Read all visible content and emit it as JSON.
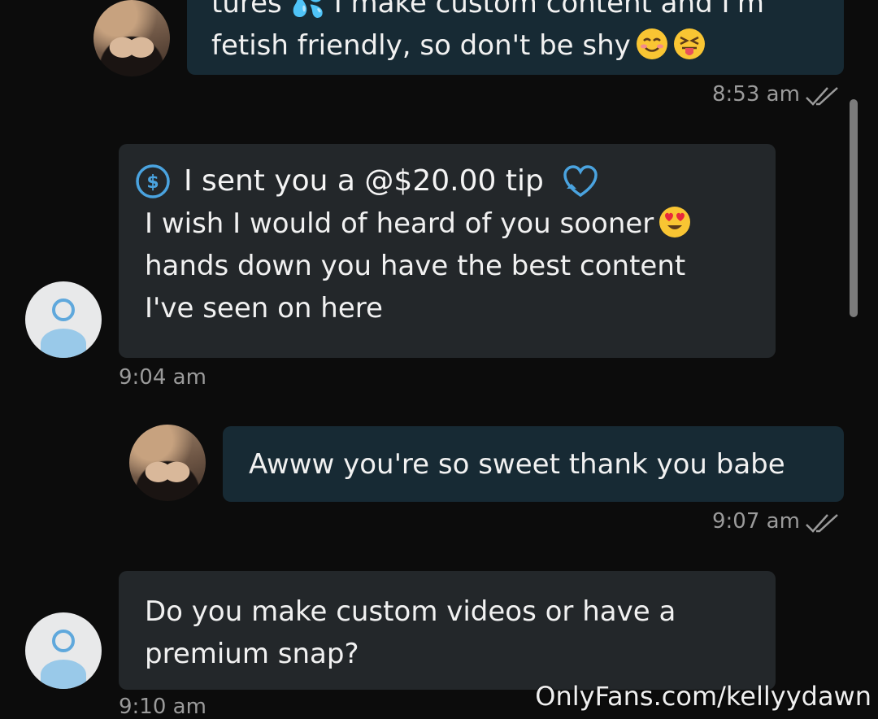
{
  "messages": [
    {
      "sender": "creator",
      "lines": [
        "tures 💦 I make custom content and I'm",
        "fetish friendly, so don't be shy"
      ],
      "emojis": [
        "smiling-face-icon",
        "squinting-tongue-face-icon"
      ],
      "time": "8:53 am",
      "status": "read"
    },
    {
      "sender": "fan",
      "tip_label": "I sent you a @$20.00 tip",
      "tip_icon": "dollar-circle-icon",
      "tip_badge_icon": "heart-icon",
      "lines": [
        "I wish I would of heard of you sooner",
        "hands down you have the best content",
        "I've seen on here"
      ],
      "emojis": [
        "heart-eyes-face-icon"
      ],
      "time": "9:04 am"
    },
    {
      "sender": "creator",
      "lines": [
        "Awww you're so sweet thank you babe"
      ],
      "time": "9:07 am",
      "status": "read"
    },
    {
      "sender": "fan",
      "lines": [
        "Do you make custom videos or have a",
        "premium snap?"
      ],
      "time": "9:10 am"
    }
  ],
  "watermark": "OnlyFans.com/kellyydawn",
  "colors": {
    "background": "#0c0c0c",
    "outgoing_bubble": "#172a34",
    "incoming_bubble": "#23272a",
    "accent": "#4aa3df"
  }
}
